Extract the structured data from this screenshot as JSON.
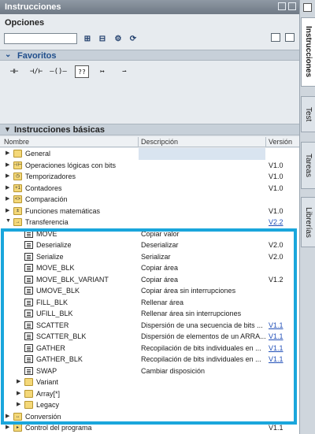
{
  "window": {
    "title": "Instrucciones"
  },
  "side_tabs": [
    "Instrucciones",
    "Test",
    "Tareas",
    "Librerías"
  ],
  "options": {
    "label": "Opciones",
    "search_value": "",
    "toolbar_icons": [
      "expand-all-icon",
      "collapse-all-icon",
      "options-icon",
      "refresh-icon"
    ]
  },
  "favorites": {
    "label": "Favoritos",
    "items": [
      {
        "icon": "normally-open-contact-icon",
        "glyph": "⊣⊢"
      },
      {
        "icon": "normally-closed-contact-icon",
        "glyph": "⊣/⊢"
      },
      {
        "icon": "coil-icon",
        "glyph": "–()–"
      },
      {
        "icon": "empty-box-icon",
        "glyph": "??"
      },
      {
        "icon": "open-branch-icon",
        "glyph": "↦"
      },
      {
        "icon": "close-branch-icon",
        "glyph": "⇀"
      }
    ]
  },
  "basic_instructions": {
    "label": "Instrucciones básicas",
    "columns": {
      "name": "Nombre",
      "description": "Descripción",
      "version": "Versión"
    },
    "rows": [
      {
        "level": 0,
        "expanded": false,
        "type": "folder",
        "cat": "",
        "name": "General",
        "desc": "",
        "ver": "",
        "hl": true
      },
      {
        "level": 0,
        "expanded": false,
        "type": "folder",
        "cat": "⊣⊢",
        "name": "Operaciones lógicas con bits",
        "desc": "",
        "ver": "V1.0"
      },
      {
        "level": 0,
        "expanded": false,
        "type": "folder",
        "cat": "◷",
        "name": "Temporizadores",
        "desc": "",
        "ver": "V1.0"
      },
      {
        "level": 0,
        "expanded": false,
        "type": "folder",
        "cat": "+1",
        "name": "Contadores",
        "desc": "",
        "ver": "V1.0"
      },
      {
        "level": 0,
        "expanded": false,
        "type": "folder",
        "cat": "<>",
        "name": "Comparación",
        "desc": "",
        "ver": ""
      },
      {
        "level": 0,
        "expanded": false,
        "type": "folder",
        "cat": "±",
        "name": "Funciones matemáticas",
        "desc": "",
        "ver": "V1.0"
      },
      {
        "level": 0,
        "expanded": true,
        "type": "folder",
        "cat": "→",
        "name": "Transferencia",
        "desc": "",
        "ver": "V2.2",
        "link": true
      },
      {
        "level": 1,
        "type": "blk",
        "name": "MOVE",
        "desc": "Copiar valor",
        "ver": ""
      },
      {
        "level": 1,
        "type": "blk",
        "name": "Deserialize",
        "desc": "Deserializar",
        "ver": "V2.0"
      },
      {
        "level": 1,
        "type": "blk",
        "name": "Serialize",
        "desc": "Serializar",
        "ver": "V2.0"
      },
      {
        "level": 1,
        "type": "blk",
        "name": "MOVE_BLK",
        "desc": "Copiar área",
        "ver": ""
      },
      {
        "level": 1,
        "type": "blk",
        "name": "MOVE_BLK_VARIANT",
        "desc": "Copiar área",
        "ver": "V1.2"
      },
      {
        "level": 1,
        "type": "blk",
        "name": "UMOVE_BLK",
        "desc": "Copiar área sin interrupciones",
        "ver": ""
      },
      {
        "level": 1,
        "type": "blk",
        "name": "FILL_BLK",
        "desc": "Rellenar área",
        "ver": ""
      },
      {
        "level": 1,
        "type": "blk",
        "name": "UFILL_BLK",
        "desc": "Rellenar área sin interrupciones",
        "ver": ""
      },
      {
        "level": 1,
        "type": "blk",
        "name": "SCATTER",
        "desc": "Dispersión de una secuencia de bits ...",
        "ver": "V1.1",
        "link": true
      },
      {
        "level": 1,
        "type": "blk",
        "name": "SCATTER_BLK",
        "desc": "Dispersión de elementos de un ARRA...",
        "ver": "V1.1",
        "link": true
      },
      {
        "level": 1,
        "type": "blk",
        "name": "GATHER",
        "desc": "Recopilación de bits individuales en ...",
        "ver": "V1.1",
        "link": true
      },
      {
        "level": 1,
        "type": "blk",
        "name": "GATHER_BLK",
        "desc": "Recopilación de bits individuales en ...",
        "ver": "V1.1",
        "link": true
      },
      {
        "level": 1,
        "type": "blk",
        "name": "SWAP",
        "desc": "Cambiar disposición",
        "ver": ""
      },
      {
        "level": 1,
        "expanded": false,
        "type": "folder",
        "cat": "",
        "name": "Variant",
        "desc": "",
        "ver": ""
      },
      {
        "level": 1,
        "expanded": false,
        "type": "folder",
        "cat": "",
        "name": "Array[*]",
        "desc": "",
        "ver": ""
      },
      {
        "level": 1,
        "expanded": false,
        "type": "folder",
        "cat": "",
        "name": "Legacy",
        "desc": "",
        "ver": ""
      },
      {
        "level": 0,
        "expanded": false,
        "type": "folder",
        "cat": "↔",
        "name": "Conversión",
        "desc": "",
        "ver": ""
      },
      {
        "level": 0,
        "expanded": false,
        "type": "folder",
        "cat": "▸",
        "name": "Control del programa",
        "desc": "",
        "ver": "V1.1"
      }
    ]
  },
  "colors": {
    "highlight_box": "#1aa6dc",
    "link": "#2250b8",
    "group_header": "#1f4e8c"
  }
}
